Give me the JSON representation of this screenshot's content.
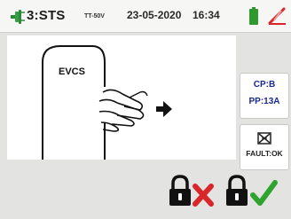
{
  "header": {
    "mode": "3:STS",
    "mode_sub": "TT-50V",
    "date": "23-05-2020",
    "time": "16:34",
    "icons": [
      "probe-icon",
      "battery-icon",
      "no-signal-icon"
    ],
    "battery_color": "#2e9a2e"
  },
  "illustration": {
    "station_label": "EVCS"
  },
  "status": {
    "cp": "CP:B",
    "pp": "PP:13A",
    "fault": "FAULT:OK",
    "text_color": "#1a2a8c"
  },
  "actions": {
    "cancel_icon": "lock-cross-icon",
    "confirm_icon": "lock-check-icon",
    "cancel_color": "#d8262b",
    "confirm_color": "#2ea32e"
  }
}
